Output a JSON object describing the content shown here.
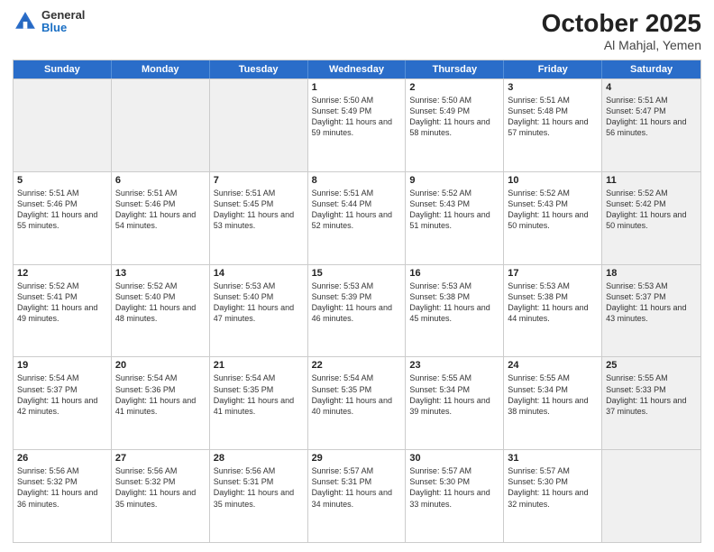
{
  "header": {
    "logo_general": "General",
    "logo_blue": "Blue",
    "title": "October 2025",
    "location": "Al Mahjal, Yemen"
  },
  "days_of_week": [
    "Sunday",
    "Monday",
    "Tuesday",
    "Wednesday",
    "Thursday",
    "Friday",
    "Saturday"
  ],
  "weeks": [
    [
      {
        "day": "",
        "info": "",
        "shaded": true
      },
      {
        "day": "",
        "info": "",
        "shaded": true
      },
      {
        "day": "",
        "info": "",
        "shaded": true
      },
      {
        "day": "1",
        "info": "Sunrise: 5:50 AM\nSunset: 5:49 PM\nDaylight: 11 hours and 59 minutes.",
        "shaded": false
      },
      {
        "day": "2",
        "info": "Sunrise: 5:50 AM\nSunset: 5:49 PM\nDaylight: 11 hours and 58 minutes.",
        "shaded": false
      },
      {
        "day": "3",
        "info": "Sunrise: 5:51 AM\nSunset: 5:48 PM\nDaylight: 11 hours and 57 minutes.",
        "shaded": false
      },
      {
        "day": "4",
        "info": "Sunrise: 5:51 AM\nSunset: 5:47 PM\nDaylight: 11 hours and 56 minutes.",
        "shaded": true
      }
    ],
    [
      {
        "day": "5",
        "info": "Sunrise: 5:51 AM\nSunset: 5:46 PM\nDaylight: 11 hours and 55 minutes.",
        "shaded": false
      },
      {
        "day": "6",
        "info": "Sunrise: 5:51 AM\nSunset: 5:46 PM\nDaylight: 11 hours and 54 minutes.",
        "shaded": false
      },
      {
        "day": "7",
        "info": "Sunrise: 5:51 AM\nSunset: 5:45 PM\nDaylight: 11 hours and 53 minutes.",
        "shaded": false
      },
      {
        "day": "8",
        "info": "Sunrise: 5:51 AM\nSunset: 5:44 PM\nDaylight: 11 hours and 52 minutes.",
        "shaded": false
      },
      {
        "day": "9",
        "info": "Sunrise: 5:52 AM\nSunset: 5:43 PM\nDaylight: 11 hours and 51 minutes.",
        "shaded": false
      },
      {
        "day": "10",
        "info": "Sunrise: 5:52 AM\nSunset: 5:43 PM\nDaylight: 11 hours and 50 minutes.",
        "shaded": false
      },
      {
        "day": "11",
        "info": "Sunrise: 5:52 AM\nSunset: 5:42 PM\nDaylight: 11 hours and 50 minutes.",
        "shaded": true
      }
    ],
    [
      {
        "day": "12",
        "info": "Sunrise: 5:52 AM\nSunset: 5:41 PM\nDaylight: 11 hours and 49 minutes.",
        "shaded": false
      },
      {
        "day": "13",
        "info": "Sunrise: 5:52 AM\nSunset: 5:40 PM\nDaylight: 11 hours and 48 minutes.",
        "shaded": false
      },
      {
        "day": "14",
        "info": "Sunrise: 5:53 AM\nSunset: 5:40 PM\nDaylight: 11 hours and 47 minutes.",
        "shaded": false
      },
      {
        "day": "15",
        "info": "Sunrise: 5:53 AM\nSunset: 5:39 PM\nDaylight: 11 hours and 46 minutes.",
        "shaded": false
      },
      {
        "day": "16",
        "info": "Sunrise: 5:53 AM\nSunset: 5:38 PM\nDaylight: 11 hours and 45 minutes.",
        "shaded": false
      },
      {
        "day": "17",
        "info": "Sunrise: 5:53 AM\nSunset: 5:38 PM\nDaylight: 11 hours and 44 minutes.",
        "shaded": false
      },
      {
        "day": "18",
        "info": "Sunrise: 5:53 AM\nSunset: 5:37 PM\nDaylight: 11 hours and 43 minutes.",
        "shaded": true
      }
    ],
    [
      {
        "day": "19",
        "info": "Sunrise: 5:54 AM\nSunset: 5:37 PM\nDaylight: 11 hours and 42 minutes.",
        "shaded": false
      },
      {
        "day": "20",
        "info": "Sunrise: 5:54 AM\nSunset: 5:36 PM\nDaylight: 11 hours and 41 minutes.",
        "shaded": false
      },
      {
        "day": "21",
        "info": "Sunrise: 5:54 AM\nSunset: 5:35 PM\nDaylight: 11 hours and 41 minutes.",
        "shaded": false
      },
      {
        "day": "22",
        "info": "Sunrise: 5:54 AM\nSunset: 5:35 PM\nDaylight: 11 hours and 40 minutes.",
        "shaded": false
      },
      {
        "day": "23",
        "info": "Sunrise: 5:55 AM\nSunset: 5:34 PM\nDaylight: 11 hours and 39 minutes.",
        "shaded": false
      },
      {
        "day": "24",
        "info": "Sunrise: 5:55 AM\nSunset: 5:34 PM\nDaylight: 11 hours and 38 minutes.",
        "shaded": false
      },
      {
        "day": "25",
        "info": "Sunrise: 5:55 AM\nSunset: 5:33 PM\nDaylight: 11 hours and 37 minutes.",
        "shaded": true
      }
    ],
    [
      {
        "day": "26",
        "info": "Sunrise: 5:56 AM\nSunset: 5:32 PM\nDaylight: 11 hours and 36 minutes.",
        "shaded": false
      },
      {
        "day": "27",
        "info": "Sunrise: 5:56 AM\nSunset: 5:32 PM\nDaylight: 11 hours and 35 minutes.",
        "shaded": false
      },
      {
        "day": "28",
        "info": "Sunrise: 5:56 AM\nSunset: 5:31 PM\nDaylight: 11 hours and 35 minutes.",
        "shaded": false
      },
      {
        "day": "29",
        "info": "Sunrise: 5:57 AM\nSunset: 5:31 PM\nDaylight: 11 hours and 34 minutes.",
        "shaded": false
      },
      {
        "day": "30",
        "info": "Sunrise: 5:57 AM\nSunset: 5:30 PM\nDaylight: 11 hours and 33 minutes.",
        "shaded": false
      },
      {
        "day": "31",
        "info": "Sunrise: 5:57 AM\nSunset: 5:30 PM\nDaylight: 11 hours and 32 minutes.",
        "shaded": false
      },
      {
        "day": "",
        "info": "",
        "shaded": true
      }
    ]
  ]
}
